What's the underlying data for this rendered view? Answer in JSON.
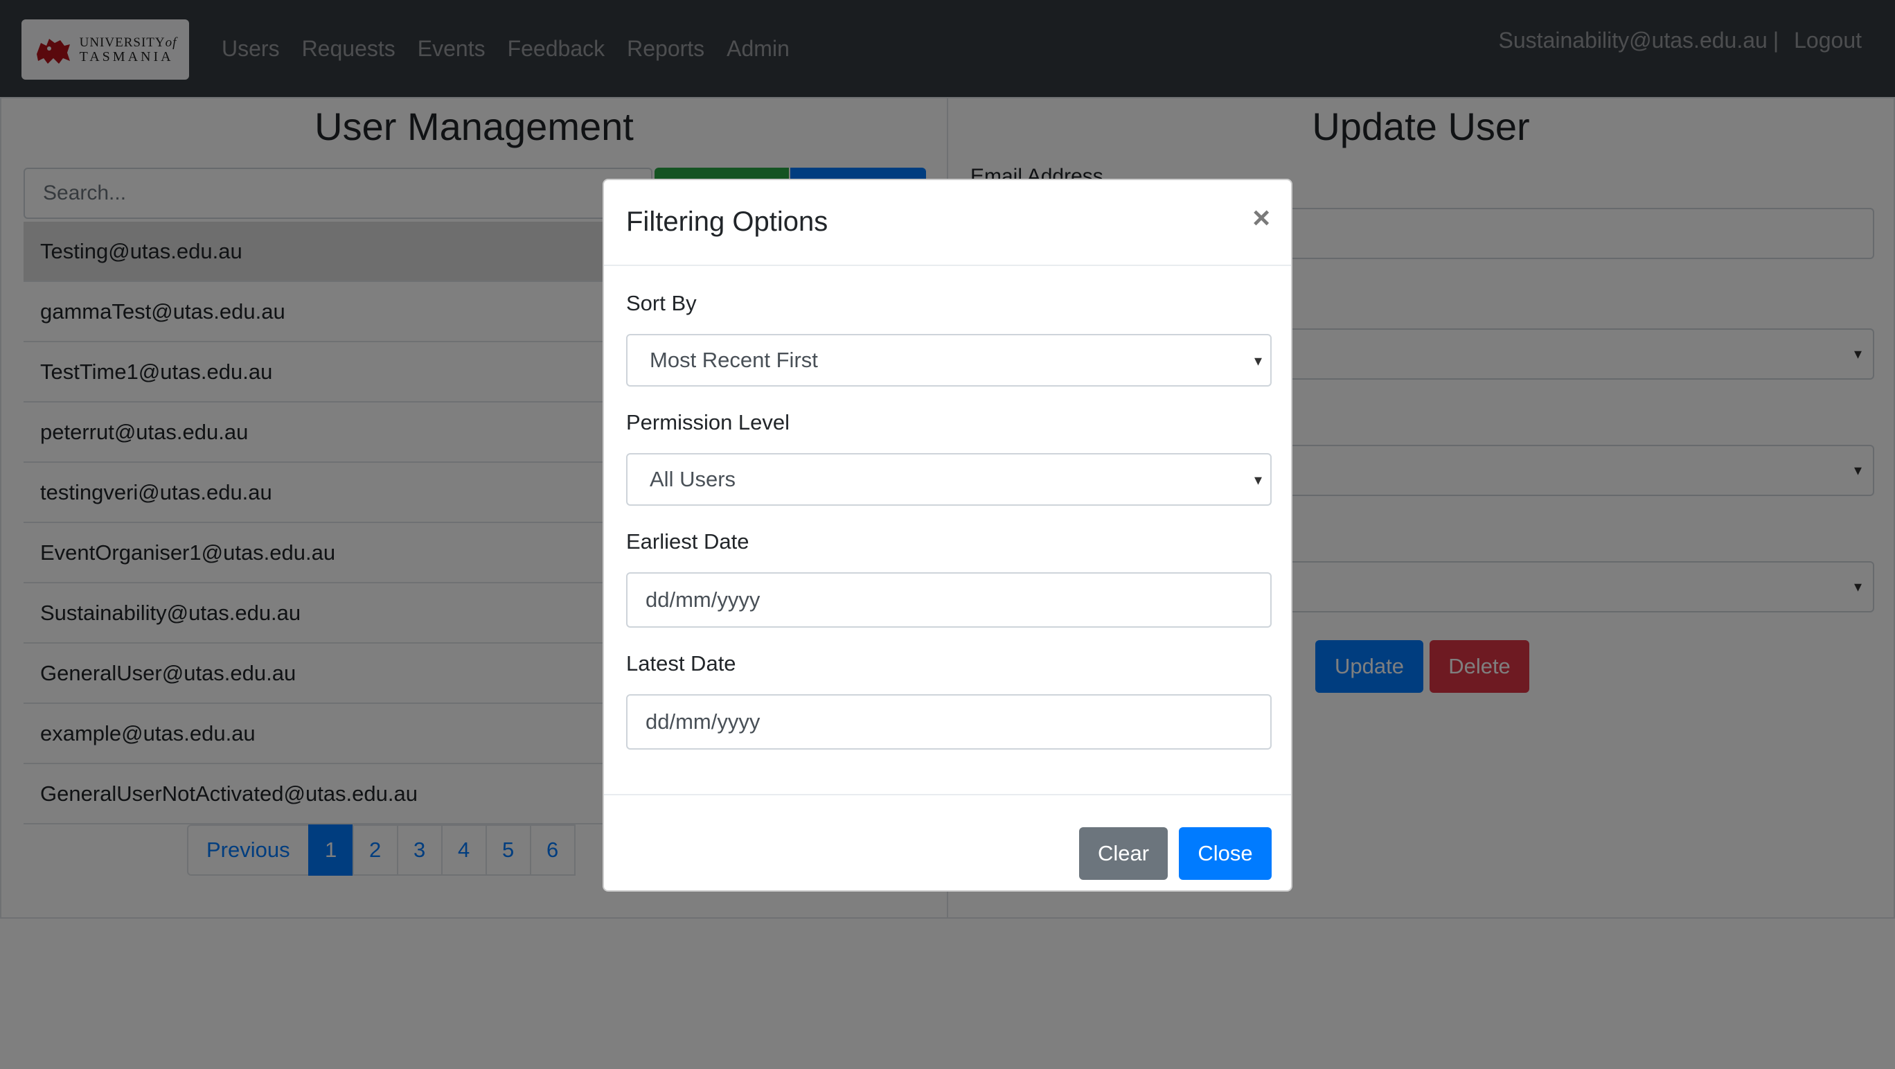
{
  "brand": {
    "line1": "UNIVERSITY",
    "line1_suffix": "of",
    "line2": "TASMANIA"
  },
  "nav": {
    "links": [
      "Users",
      "Requests",
      "Events",
      "Feedback",
      "Reports",
      "Admin"
    ],
    "user_email": "Sustainability@utas.edu.au",
    "separator": "|",
    "logout": "Logout"
  },
  "user_management": {
    "title": "User Management",
    "search_placeholder": "Search...",
    "users": [
      "Testing@utas.edu.au",
      "gammaTest@utas.edu.au",
      "TestTime1@utas.edu.au",
      "peterrut@utas.edu.au",
      "testingveri@utas.edu.au",
      "EventOrganiser1@utas.edu.au",
      "Sustainability@utas.edu.au",
      "GeneralUser@utas.edu.au",
      "example@utas.edu.au",
      "GeneralUserNotActivated@utas.edu.au"
    ],
    "pagination": {
      "previous": "Previous",
      "pages": [
        "1",
        "2",
        "3",
        "4",
        "5",
        "6"
      ],
      "active": "1"
    }
  },
  "update_user": {
    "title": "Update User",
    "email_label": "Email Address",
    "update_button": "Update",
    "delete_button": "Delete"
  },
  "modal": {
    "title": "Filtering Options",
    "close_symbol": "×",
    "sort_by_label": "Sort By",
    "sort_by_value": "Most Recent First",
    "permission_label": "Permission Level",
    "permission_value": "All Users",
    "earliest_label": "Earliest Date",
    "earliest_placeholder": "dd/mm/yyyy",
    "latest_label": "Latest Date",
    "latest_placeholder": "dd/mm/yyyy",
    "clear_button": "Clear",
    "close_button": "Close"
  },
  "colors": {
    "primary": "#007bff",
    "success": "#28a745",
    "danger": "#dc3545",
    "secondary": "#6c757d",
    "navbar": "#343a40"
  }
}
